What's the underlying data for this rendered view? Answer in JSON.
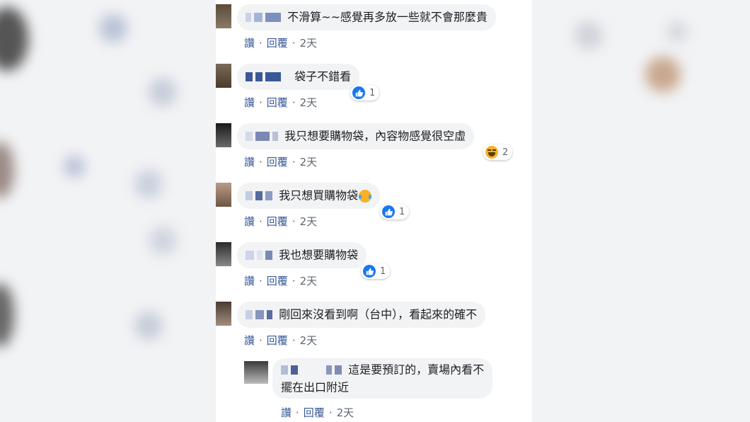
{
  "actions": {
    "like": "讚",
    "reply": "回覆",
    "separator": "·"
  },
  "comments": [
    {
      "text": "不滑算~~感覺再多放一些就不會那麼貴",
      "time": "2天"
    },
    {
      "text": "袋子不錯看",
      "time": "2天",
      "reaction_count": "1",
      "reaction": "like"
    },
    {
      "text": "我只想要購物袋，內容物感覺很空虛",
      "time": "2天",
      "reaction_count": "2",
      "reaction": "haha"
    },
    {
      "text": "我只想買購物袋",
      "time": "2天",
      "reaction_count": "1",
      "reaction": "like",
      "inline_emoji": "tears-of-joy-emoji"
    },
    {
      "text": "我也想要購物袋",
      "time": "2天",
      "reaction_count": "1",
      "reaction": "like"
    },
    {
      "text": "剛回來沒看到啊（台中），看起來的確不",
      "time": "2天"
    }
  ],
  "reply": {
    "text_line1": "這是要預訂的，賣場內看不",
    "text_line2": "擺在出口附近",
    "time": "2天"
  },
  "colors": {
    "link": "#385898",
    "bubble": "#f2f3f5",
    "like_blue": "#1877f2",
    "meta": "#606770"
  }
}
